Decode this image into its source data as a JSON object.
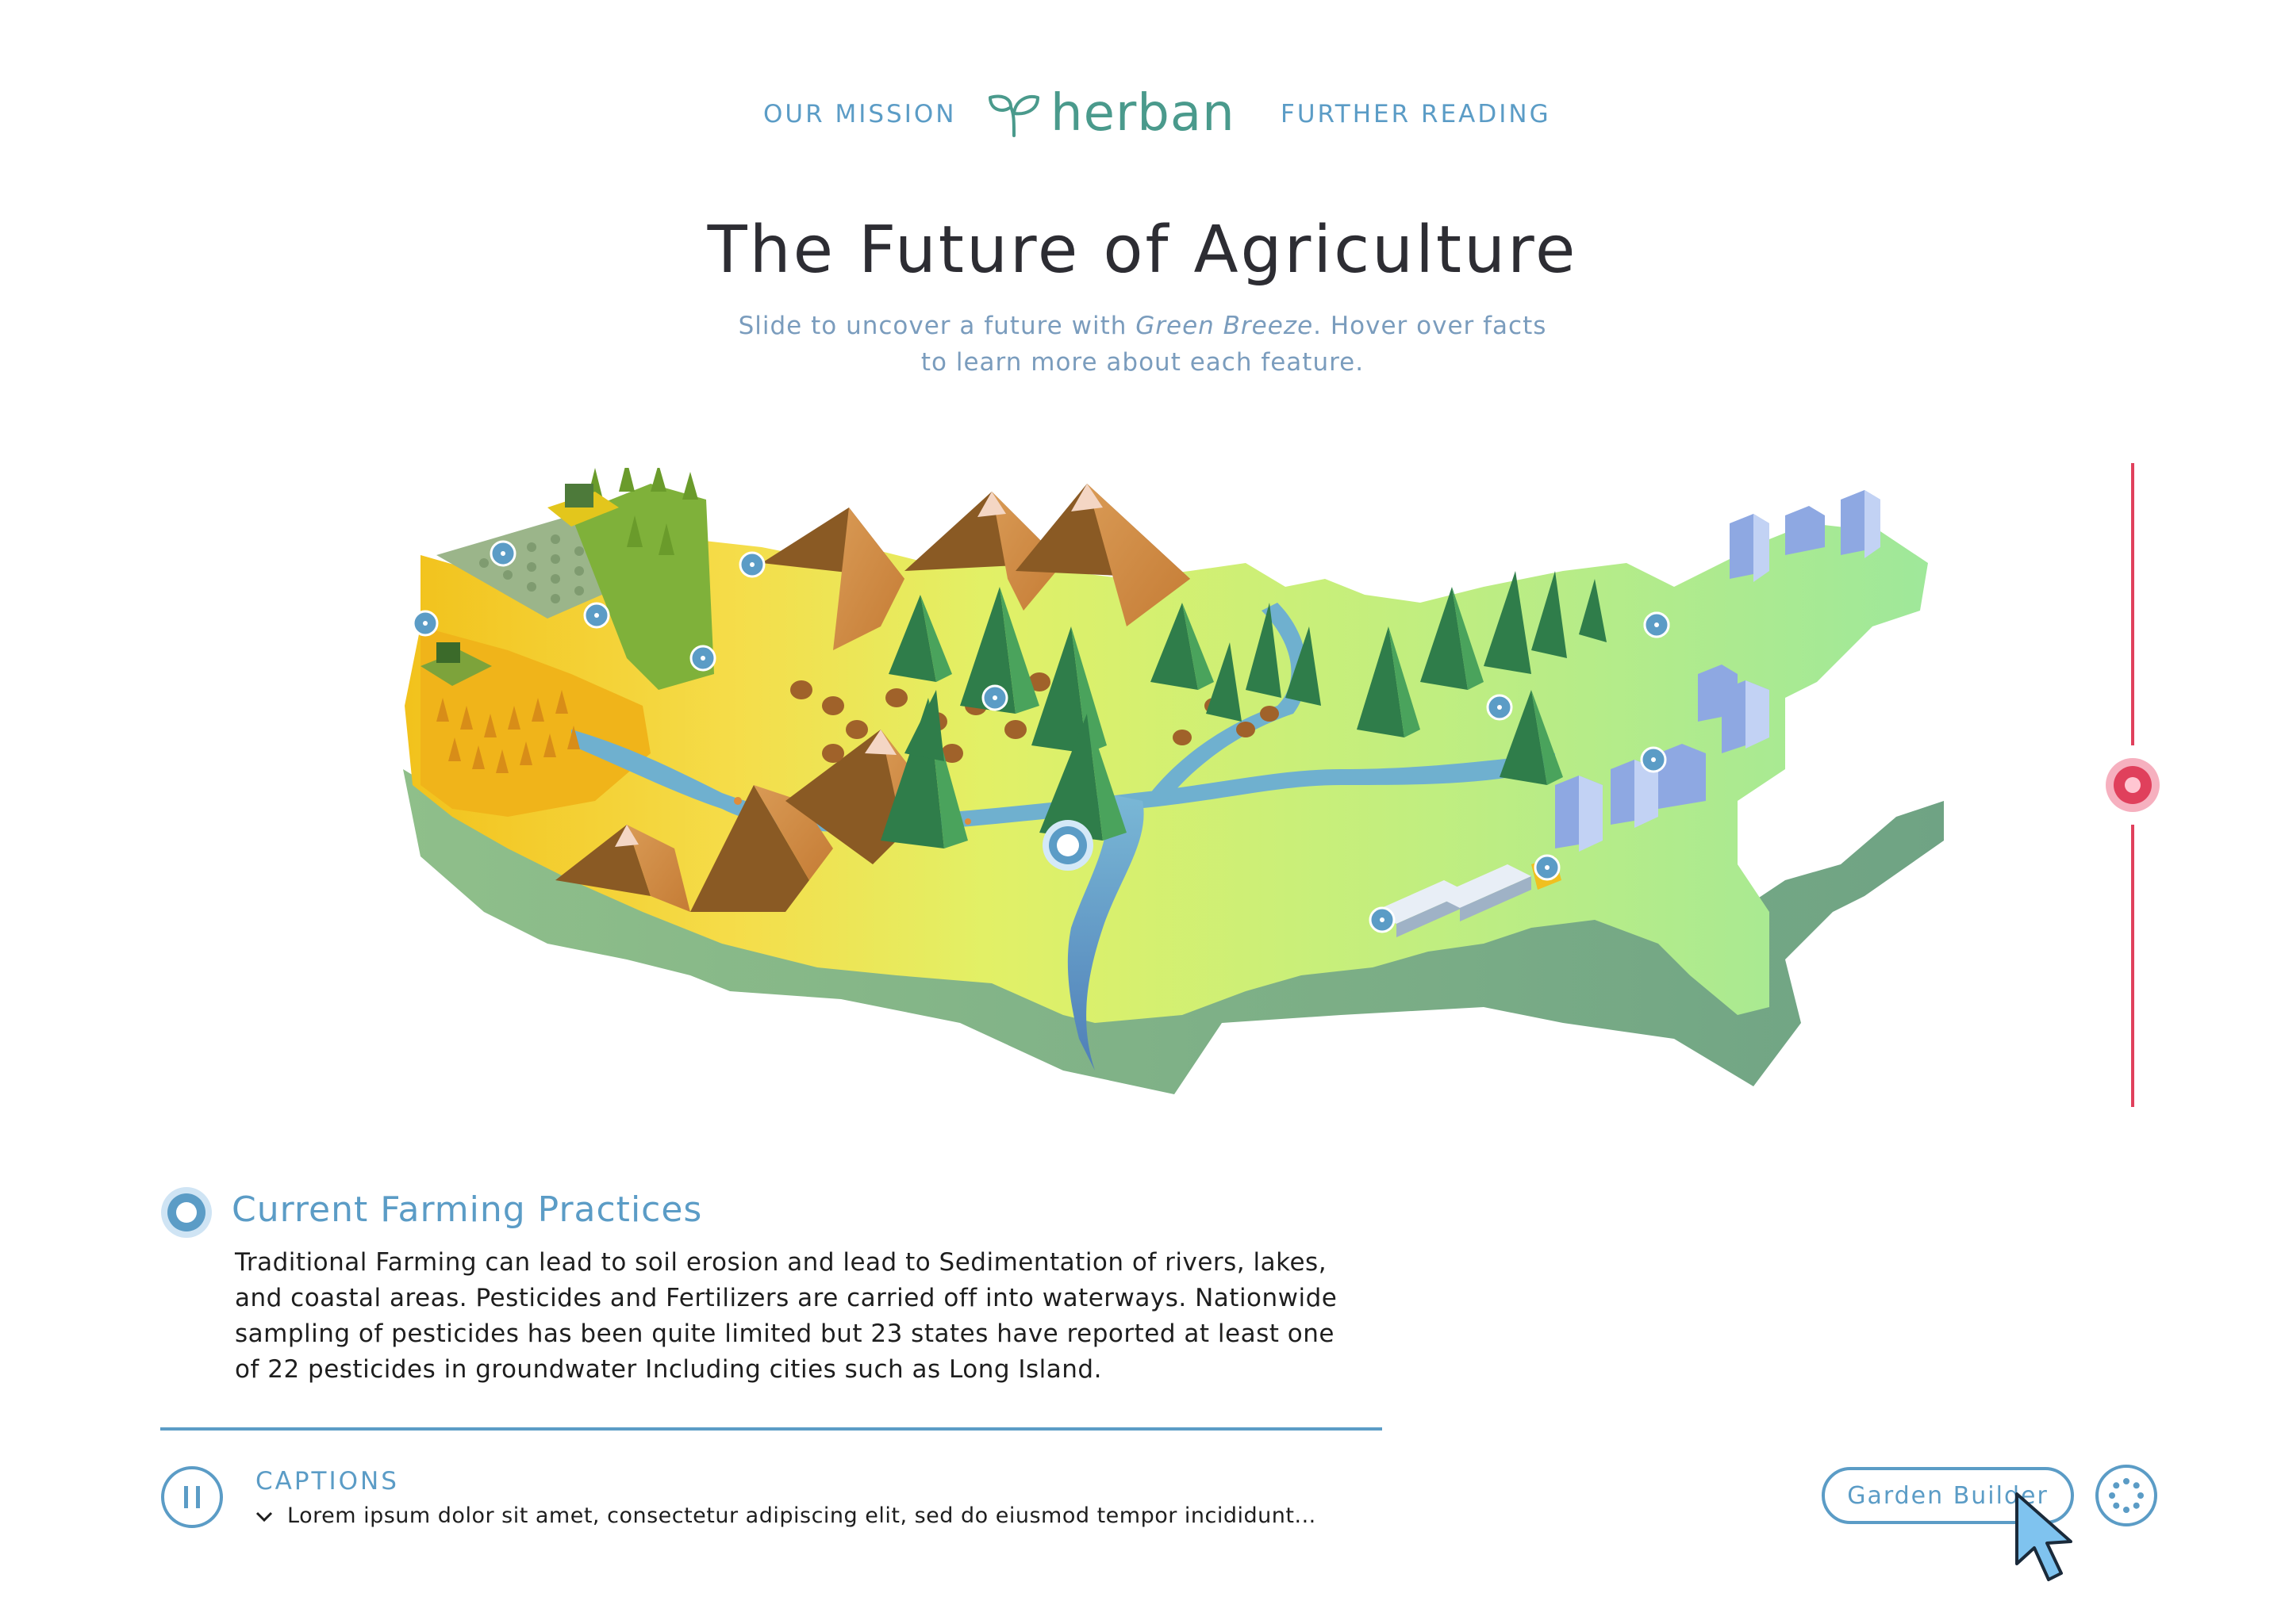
{
  "nav": {
    "mission_label": "OUR MISSION",
    "logo_text": "herban",
    "further_label": "FURTHER READING"
  },
  "hero": {
    "title": "The Future of Agriculture",
    "subtitle_pre": "Slide to uncover a future with ",
    "subtitle_brand": "Green Breeze",
    "subtitle_post": ". Hover over facts",
    "subtitle_line2": "to learn more about each feature."
  },
  "map": {
    "hotspot_count": 11,
    "active_hotspot": "river-center"
  },
  "slider": {
    "position": 0.5
  },
  "feature": {
    "title": "Current Farming Practices",
    "body_lines": [
      "Traditional Farming can lead to soil erosion and lead to Sedimentation of rivers, lakes,",
      "and coastal areas. Pesticides and Fertilizers are carried off into waterways. Nationwide",
      "sampling of pesticides has been quite limited but 23 states have reported at least one",
      "of 22 pesticides in groundwater Including cities such as Long Island."
    ]
  },
  "captions": {
    "label": "CAPTIONS",
    "text": "Lorem ipsum dolor sit amet, consectetur adipiscing elit, sed do eiusmod tempor incididunt..."
  },
  "actions": {
    "garden_builder_label": "Garden Builder"
  },
  "icons": {
    "pause": "pause-icon",
    "chevron": "chevron-down-icon",
    "settings": "settings-dots-icon",
    "cursor": "mouse-pointer-icon",
    "leaf": "leaf-logo-icon"
  },
  "colors": {
    "accent_blue": "#5b9cc6",
    "logo_teal": "#4a9a8c",
    "slider_red": "#e0405c",
    "title_dark": "#2d2d33",
    "subtitle": "#7a9cbd"
  }
}
